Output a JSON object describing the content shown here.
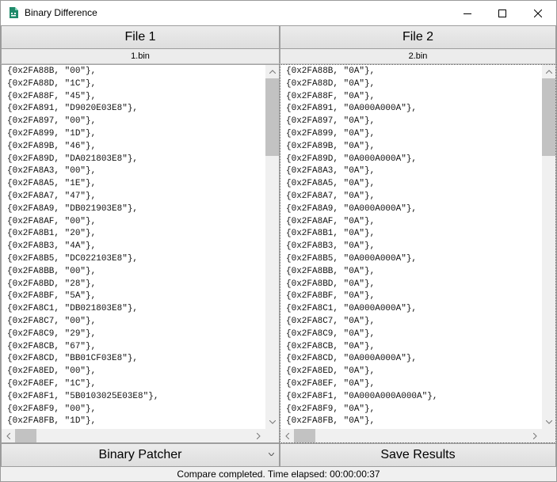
{
  "window": {
    "title": "Binary Difference",
    "icon": "app-icon",
    "controls": [
      "minimize-icon",
      "maximize-icon",
      "close-icon"
    ]
  },
  "left_panel": {
    "header": "File 1",
    "file_name": "1.bin",
    "lines": [
      "{0x2FA88B, \"00\"},",
      "{0x2FA88D, \"1C\"},",
      "{0x2FA88F, \"45\"},",
      "{0x2FA891, \"D9020E03E8\"},",
      "{0x2FA897, \"00\"},",
      "{0x2FA899, \"1D\"},",
      "{0x2FA89B, \"46\"},",
      "{0x2FA89D, \"DA021803E8\"},",
      "{0x2FA8A3, \"00\"},",
      "{0x2FA8A5, \"1E\"},",
      "{0x2FA8A7, \"47\"},",
      "{0x2FA8A9, \"DB021903E8\"},",
      "{0x2FA8AF, \"00\"},",
      "{0x2FA8B1, \"20\"},",
      "{0x2FA8B3, \"4A\"},",
      "{0x2FA8B5, \"DC022103E8\"},",
      "{0x2FA8BB, \"00\"},",
      "{0x2FA8BD, \"28\"},",
      "{0x2FA8BF, \"5A\"},",
      "{0x2FA8C1, \"DB021803E8\"},",
      "{0x2FA8C7, \"00\"},",
      "{0x2FA8C9, \"29\"},",
      "{0x2FA8CB, \"67\"},",
      "{0x2FA8CD, \"BB01CF03E8\"},",
      "{0x2FA8ED, \"00\"},",
      "{0x2FA8EF, \"1C\"},",
      "{0x2FA8F1, \"5B0103025E03E8\"},",
      "{0x2FA8F9, \"00\"},",
      "{0x2FA8FB, \"1D\"},"
    ]
  },
  "right_panel": {
    "header": "File 2",
    "file_name": "2.bin",
    "lines": [
      "{0x2FA88B, \"0A\"},",
      "{0x2FA88D, \"0A\"},",
      "{0x2FA88F, \"0A\"},",
      "{0x2FA891, \"0A000A000A\"},",
      "{0x2FA897, \"0A\"},",
      "{0x2FA899, \"0A\"},",
      "{0x2FA89B, \"0A\"},",
      "{0x2FA89D, \"0A000A000A\"},",
      "{0x2FA8A3, \"0A\"},",
      "{0x2FA8A5, \"0A\"},",
      "{0x2FA8A7, \"0A\"},",
      "{0x2FA8A9, \"0A000A000A\"},",
      "{0x2FA8AF, \"0A\"},",
      "{0x2FA8B1, \"0A\"},",
      "{0x2FA8B3, \"0A\"},",
      "{0x2FA8B5, \"0A000A000A\"},",
      "{0x2FA8BB, \"0A\"},",
      "{0x2FA8BD, \"0A\"},",
      "{0x2FA8BF, \"0A\"},",
      "{0x2FA8C1, \"0A000A000A\"},",
      "{0x2FA8C7, \"0A\"},",
      "{0x2FA8C9, \"0A\"},",
      "{0x2FA8CB, \"0A\"},",
      "{0x2FA8CD, \"0A000A000A\"},",
      "{0x2FA8ED, \"0A\"},",
      "{0x2FA8EF, \"0A\"},",
      "{0x2FA8F1, \"0A000A000A000A\"},",
      "{0x2FA8F9, \"0A\"},",
      "{0x2FA8FB, \"0A\"},"
    ]
  },
  "buttons": {
    "binary_patcher": "Binary Patcher",
    "save_results": "Save Results"
  },
  "status": {
    "text": "Compare completed. Time elapsed: 00:00:00:37"
  },
  "colors": {
    "icon_accent": "#1f8a6a",
    "scroll_thumb": "#c2c2c2"
  }
}
